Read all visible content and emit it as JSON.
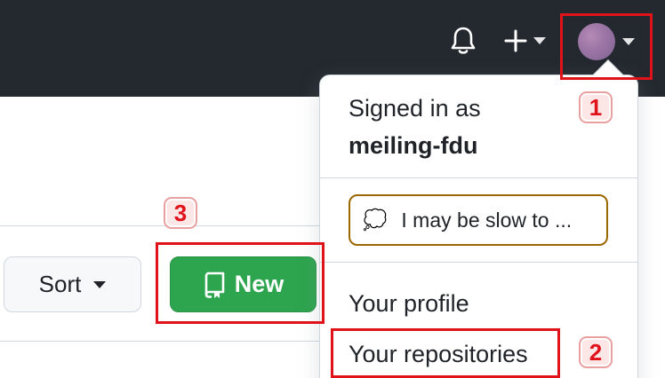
{
  "header": {
    "notifications_icon": "bell-icon",
    "create_icon": "plus-icon",
    "avatar_caret_icon": "caret-down-icon"
  },
  "toolbar": {
    "sort_label": "Sort",
    "new_label": "New",
    "new_icon": "repo-icon"
  },
  "dropdown": {
    "signed_in_label": "Signed in as",
    "username": "meiling-fdu",
    "status_emoji": "💭",
    "status_text": "I may be slow to ...",
    "items": [
      {
        "label": "Your profile"
      },
      {
        "label": "Your repositories"
      }
    ]
  },
  "annotations": {
    "step1": "1",
    "step2": "2",
    "step3": "3"
  },
  "colors": {
    "header_bg": "#24292f",
    "new_button_bg": "#2da44e",
    "annotation_red": "#e0131b",
    "status_border": "#9a6700"
  }
}
